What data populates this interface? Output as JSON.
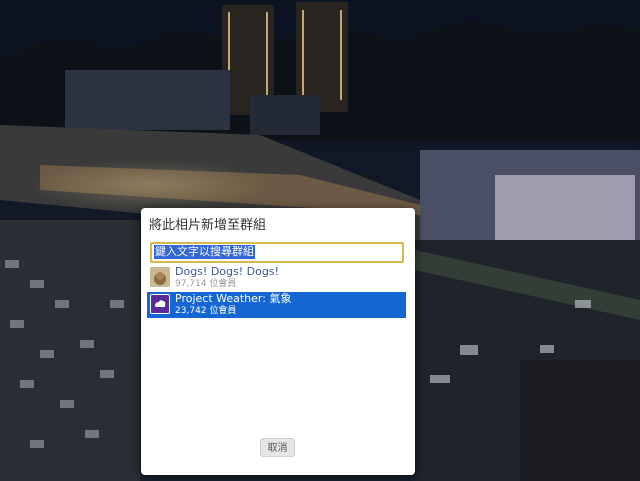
{
  "dialog": {
    "title": "將此相片新增至群組",
    "search_value": "鍵入文字以搜尋群組",
    "groups": [
      {
        "name": "Dogs! Dogs! Dogs!",
        "members": "97,714 位會員",
        "selected": false
      },
      {
        "name": "Project Weather: 氣象",
        "members": "23,742 位會員",
        "selected": true
      }
    ],
    "cancel_label": "取消"
  },
  "colors": {
    "selection": "#1467d2",
    "search_border": "#d8b84a",
    "link": "#3b5998"
  }
}
